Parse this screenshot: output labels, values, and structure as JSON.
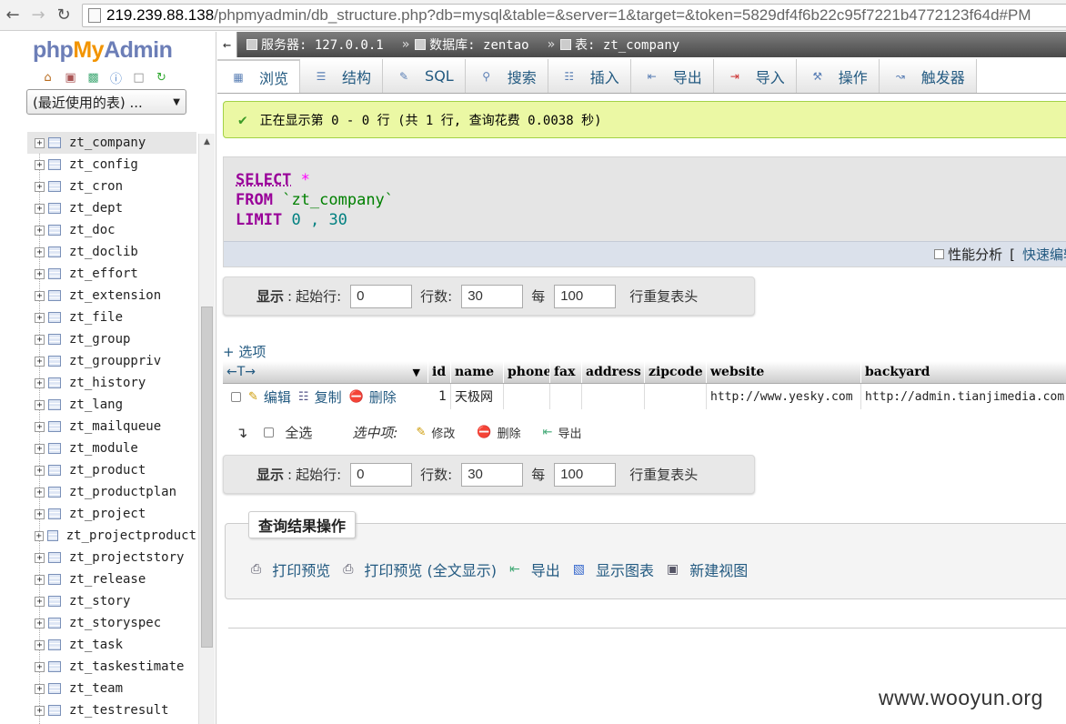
{
  "browser": {
    "url_host": "219.239.88.138",
    "url_rest": "/phpmyadmin/db_structure.php?db=mysql&table=&server=1&target=&token=5829df4f6b22c95f7221b4772123f64d#PM"
  },
  "sidebar": {
    "logo": {
      "php": "php",
      "my": "My",
      "admin": "Admin"
    },
    "recent_select": "(最近使用的表) ...",
    "tables": [
      "zt_company",
      "zt_config",
      "zt_cron",
      "zt_dept",
      "zt_doc",
      "zt_doclib",
      "zt_effort",
      "zt_extension",
      "zt_file",
      "zt_group",
      "zt_grouppriv",
      "zt_history",
      "zt_lang",
      "zt_mailqueue",
      "zt_module",
      "zt_product",
      "zt_productplan",
      "zt_project",
      "zt_projectproduct",
      "zt_projectstory",
      "zt_release",
      "zt_story",
      "zt_storyspec",
      "zt_task",
      "zt_taskestimate",
      "zt_team",
      "zt_testresult"
    ]
  },
  "breadcrumb": {
    "server": "服务器: 127.0.0.1",
    "database": "数据库: zentao",
    "table": "表: zt_company"
  },
  "tabs": [
    "浏览",
    "结构",
    "SQL",
    "搜索",
    "插入",
    "导出",
    "导入",
    "操作",
    "触发器"
  ],
  "message": "正在显示第 0 - 0 行 (共 1 行, 查询花费 0.0038 秒)",
  "sql": {
    "select": "SELECT",
    "star": "*",
    "from": "FROM",
    "table": "`zt_company`",
    "limit": "LIMIT",
    "offset": "0",
    "comma": ",",
    "count": "30",
    "profiling": "性能分析",
    "bracket": "[",
    "inline_edit": "快速编辑"
  },
  "nav": {
    "show": "显示",
    "colon": ":",
    "start_label": "起始行:",
    "start_value": "0",
    "rows_label": "行数:",
    "rows_value": "30",
    "every_label": "每",
    "every_value": "100",
    "repeat_label": "行重复表头"
  },
  "options_link": "+ 选项",
  "results": {
    "sort_icons": "←T→",
    "columns": [
      "id",
      "name",
      "phone",
      "fax",
      "address",
      "zipcode",
      "website",
      "backyard"
    ],
    "row": {
      "edit": "编辑",
      "copy": "复制",
      "delete": "删除",
      "cells": [
        "1",
        "天极网",
        "",
        "",
        "",
        "",
        "http://www.yesky.com",
        "http://admin.tianjimedia.com"
      ]
    }
  },
  "bulk": {
    "check_all": "全选",
    "with_selected": "选中项:",
    "edit": "修改",
    "delete": "删除",
    "export": "导出"
  },
  "query_ops": {
    "legend": "查询结果操作",
    "items": [
      "打印预览",
      "打印预览 (全文显示)",
      "导出",
      "显示图表",
      "新建视图"
    ]
  },
  "watermark": "www.wooyun.org"
}
